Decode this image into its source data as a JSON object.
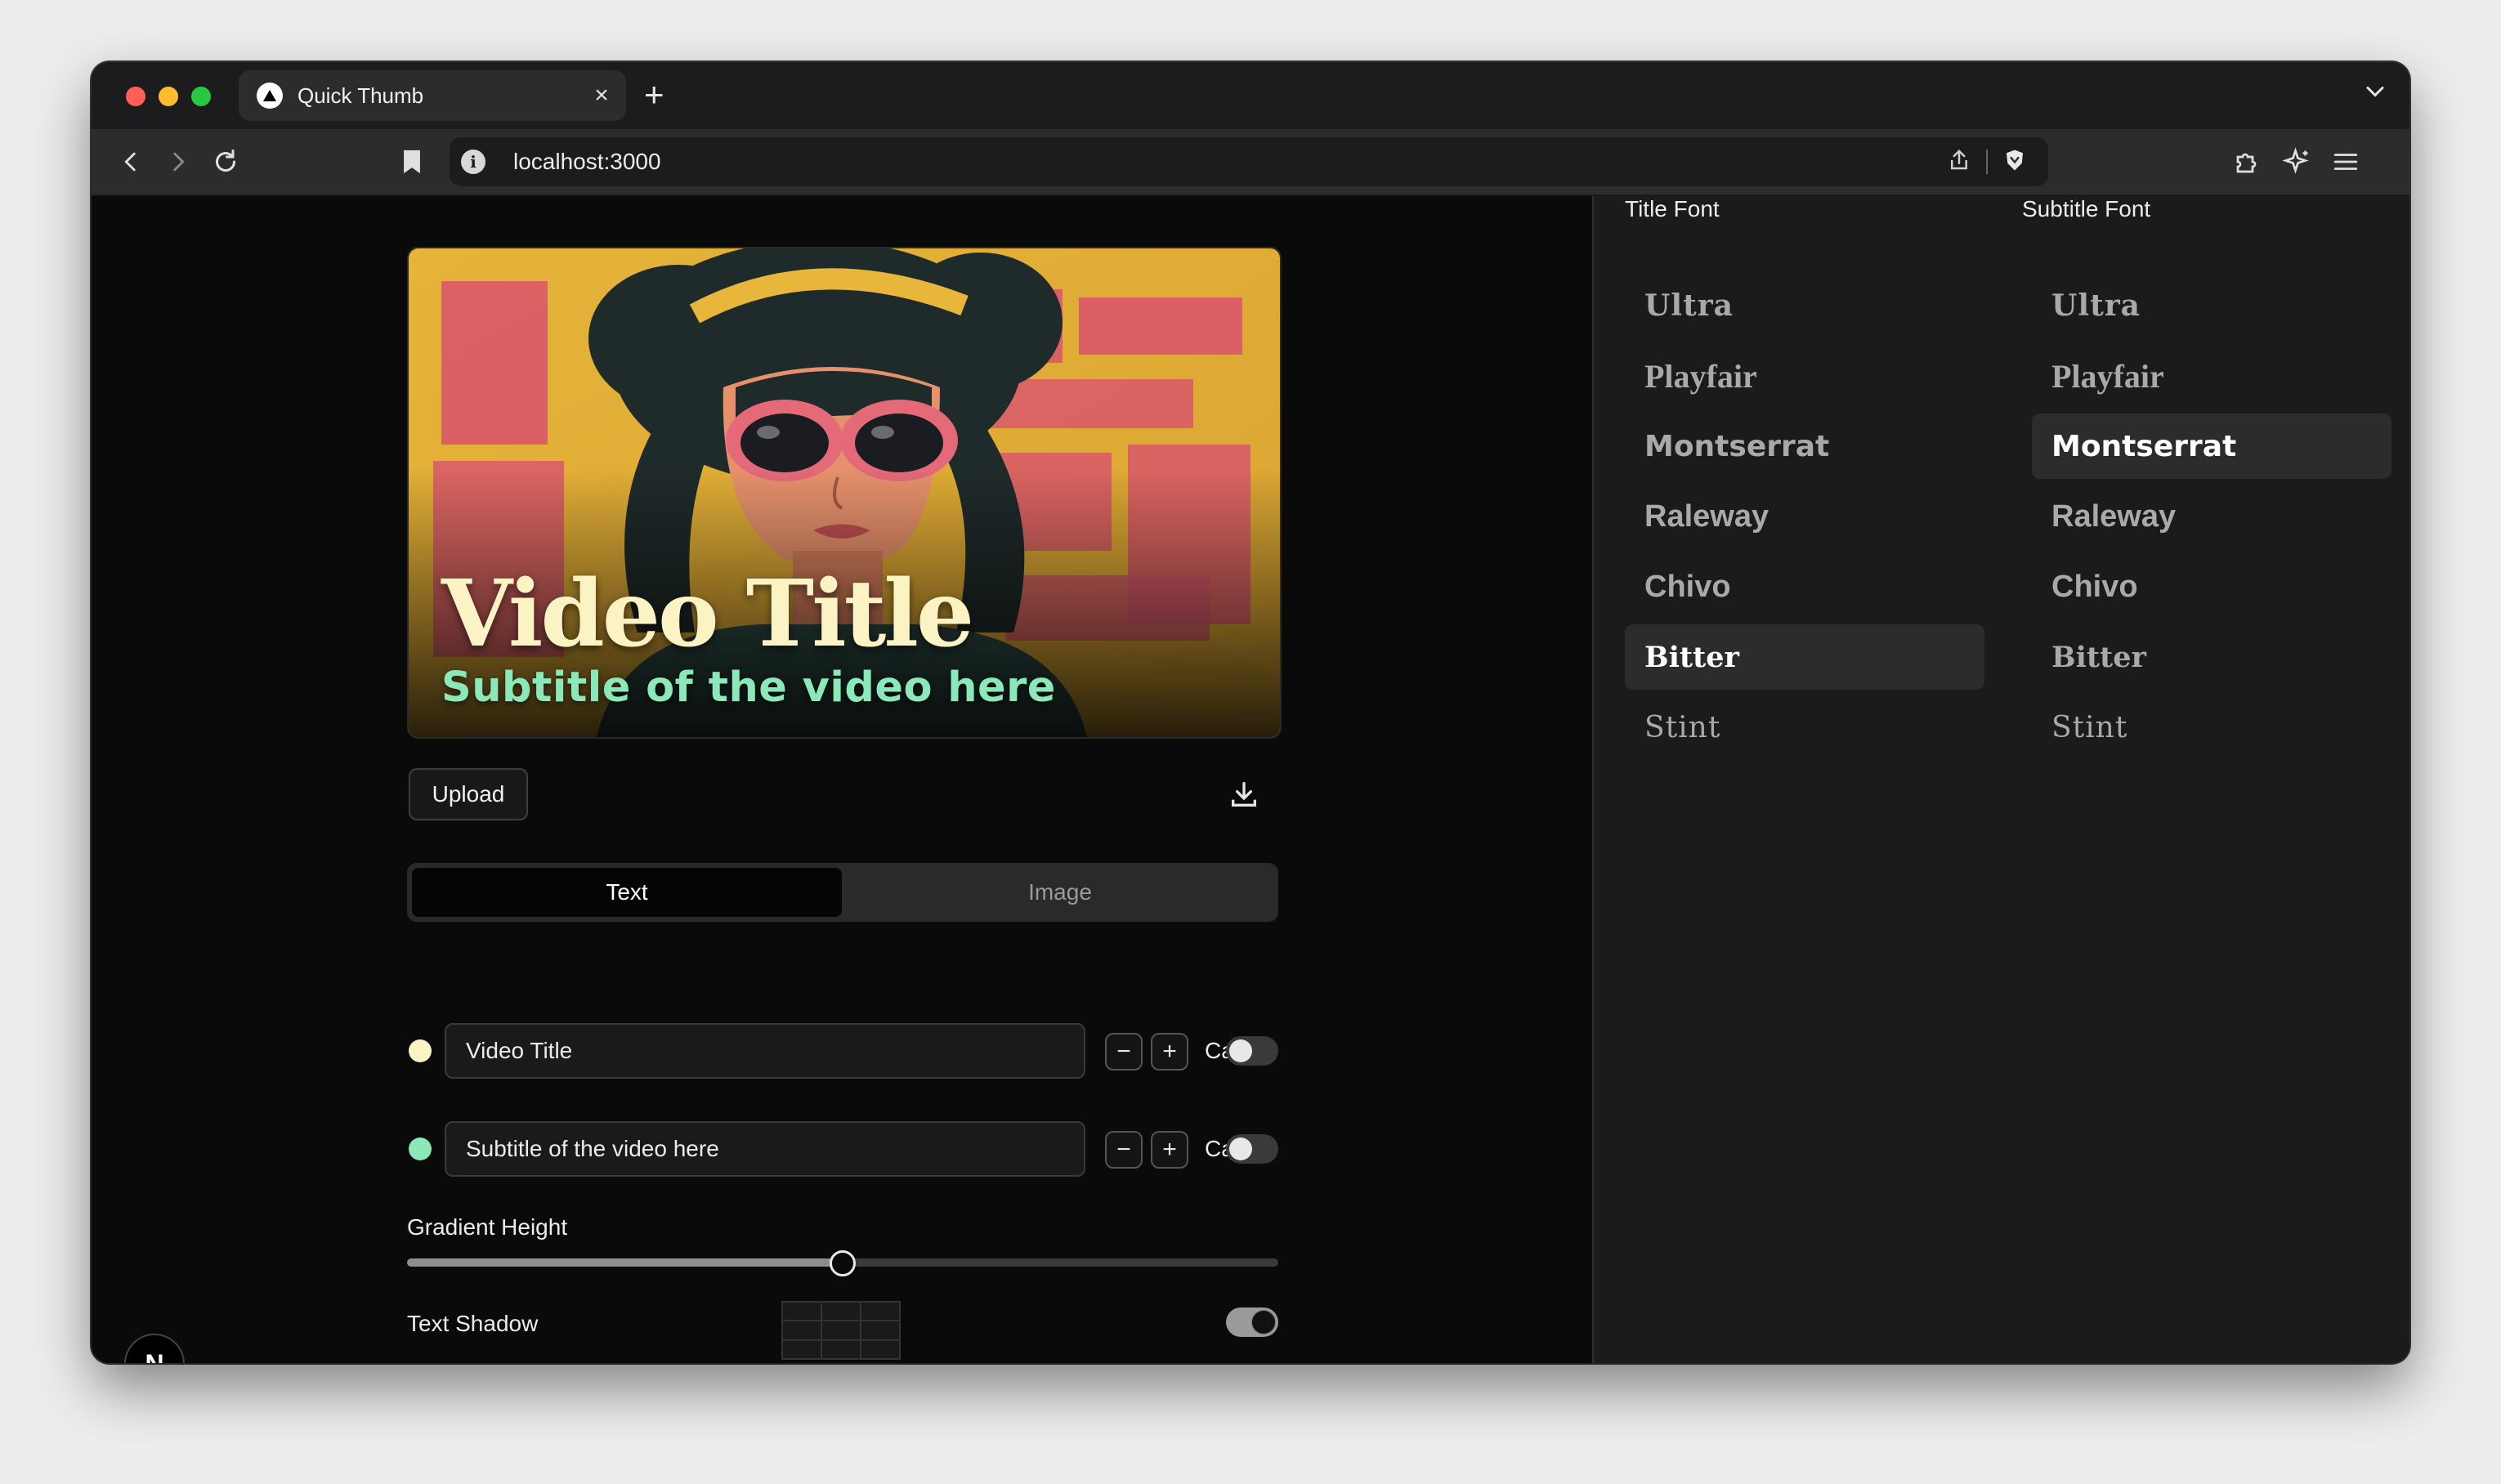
{
  "browser": {
    "tab_title": "Quick Thumb",
    "url": "localhost:3000",
    "new_tab_label": "+",
    "close_tab_label": "×"
  },
  "thumbnail": {
    "title": "Video Title",
    "subtitle": "Subtitle of the video here",
    "title_color": "#fcf3c4",
    "subtitle_color": "#8be8b8"
  },
  "actions": {
    "upload_label": "Upload"
  },
  "tabs": {
    "text_label": "Text",
    "image_label": "Image",
    "active": "Text"
  },
  "fields": {
    "title_value": "Video Title",
    "subtitle_value": "Subtitle of the video here",
    "caps_label": "Caps",
    "title_caps": false,
    "subtitle_caps": false
  },
  "gradient": {
    "label": "Gradient Height",
    "value_fraction": 0.5
  },
  "shadow": {
    "label": "Text Shadow",
    "enabled": true
  },
  "fonts": {
    "title_header": "Title Font",
    "subtitle_header": "Subtitle Font",
    "options": [
      "Ultra",
      "Playfair",
      "Montserrat",
      "Raleway",
      "Chivo",
      "Bitter",
      "Stint"
    ],
    "title_selected": "Bitter",
    "subtitle_selected": "Montserrat"
  },
  "badge": {
    "label": "N"
  },
  "colors": {
    "background": "#0a0a0b",
    "panel": "#1b1b1d",
    "selected_item": "#2c2c2f"
  }
}
